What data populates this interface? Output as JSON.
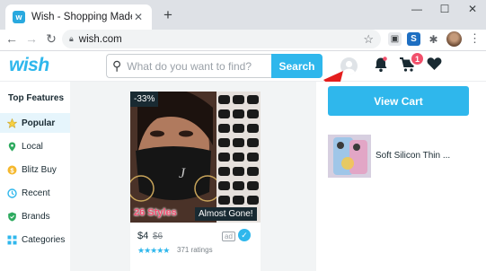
{
  "browser": {
    "tab_title": "Wish - Shopping Made Fun",
    "tab_favicon": "wish-favicon",
    "url": "wish.com",
    "new_tab_label": "+",
    "window_controls": [
      "minimize-icon",
      "maximize-icon",
      "close-icon"
    ]
  },
  "header": {
    "logo": "wish",
    "search_placeholder": "What do you want to find?",
    "search_button": "Search",
    "cart_count": "1",
    "icons": [
      "user-icon",
      "bell-icon",
      "cart-icon",
      "heart-icon"
    ],
    "accent_color": "#2fb7ec",
    "badge_color": "#f1506b"
  },
  "sidebar": {
    "title": "Top Features",
    "items": [
      {
        "label": "Popular",
        "icon": "star-icon",
        "active": true
      },
      {
        "label": "Local",
        "icon": "location-icon",
        "active": false
      },
      {
        "label": "Blitz Buy",
        "icon": "dollar-icon",
        "active": false
      },
      {
        "label": "Recent",
        "icon": "clock-icon",
        "active": false
      },
      {
        "label": "Brands",
        "icon": "shield-icon",
        "active": false
      },
      {
        "label": "Categories",
        "icon": "grid-icon",
        "active": false
      }
    ]
  },
  "product": {
    "discount": "-33%",
    "styles_label": "26 Styles",
    "stock_label": "Almost Gone!",
    "price": "$4",
    "old_price": "$6",
    "ad_label": "ad",
    "rating_stars": 4.5,
    "rating_count": "371 ratings"
  },
  "cart_panel": {
    "view_cart": "View Cart",
    "item_name": "Soft Silicon Thin ..."
  }
}
